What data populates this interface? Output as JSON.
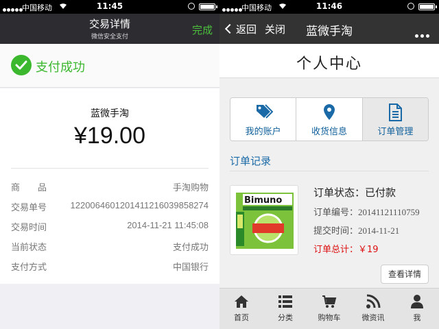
{
  "left": {
    "status_bar": {
      "carrier": "中国移动",
      "time": "11:45"
    },
    "nav": {
      "title": "交易详情",
      "subtitle": "微信安全支付",
      "done": "完成"
    },
    "success": {
      "message": "支付成功",
      "color": "#3bb82e"
    },
    "receipt": {
      "merchant": "蓝微手淘",
      "amount": "¥19.00",
      "rows": [
        {
          "label": "商　　品",
          "value": "手淘购物"
        },
        {
          "label": "交易单号",
          "value": "1220064601201411216039858274"
        },
        {
          "label": "交易时间",
          "value": "2014-11-21 11:45:08"
        },
        {
          "label": "当前状态",
          "value": "支付成功"
        },
        {
          "label": "支付方式",
          "value": "中国银行"
        }
      ]
    }
  },
  "right": {
    "status_bar": {
      "carrier": "中国移动",
      "time": "11:46"
    },
    "nav": {
      "back": "返回",
      "close": "关闭",
      "title": "蓝微手淘"
    },
    "page_title": "个人中心",
    "tiles": [
      {
        "label": "我的账户",
        "icon": "tags-icon"
      },
      {
        "label": "收货信息",
        "icon": "map-marker-icon"
      },
      {
        "label": "订单管理",
        "icon": "document-icon"
      }
    ],
    "section_title": "订单记录",
    "order": {
      "status": "订单状态：已付款",
      "number_label": "订单编号：",
      "number": "20141121110759",
      "time_label": "提交时间：",
      "time": "2014-11-21",
      "total": "订单总计：￥19",
      "product_brand": "Bimuno",
      "detail_button": "查看详情"
    },
    "tabbar": [
      {
        "label": "首页",
        "icon": "home-icon"
      },
      {
        "label": "分类",
        "icon": "list-icon"
      },
      {
        "label": "购物车",
        "icon": "cart-icon"
      },
      {
        "label": "微资讯",
        "icon": "rss-icon"
      },
      {
        "label": "我",
        "icon": "user-icon"
      }
    ],
    "accent_color": "#1b6aa8"
  }
}
